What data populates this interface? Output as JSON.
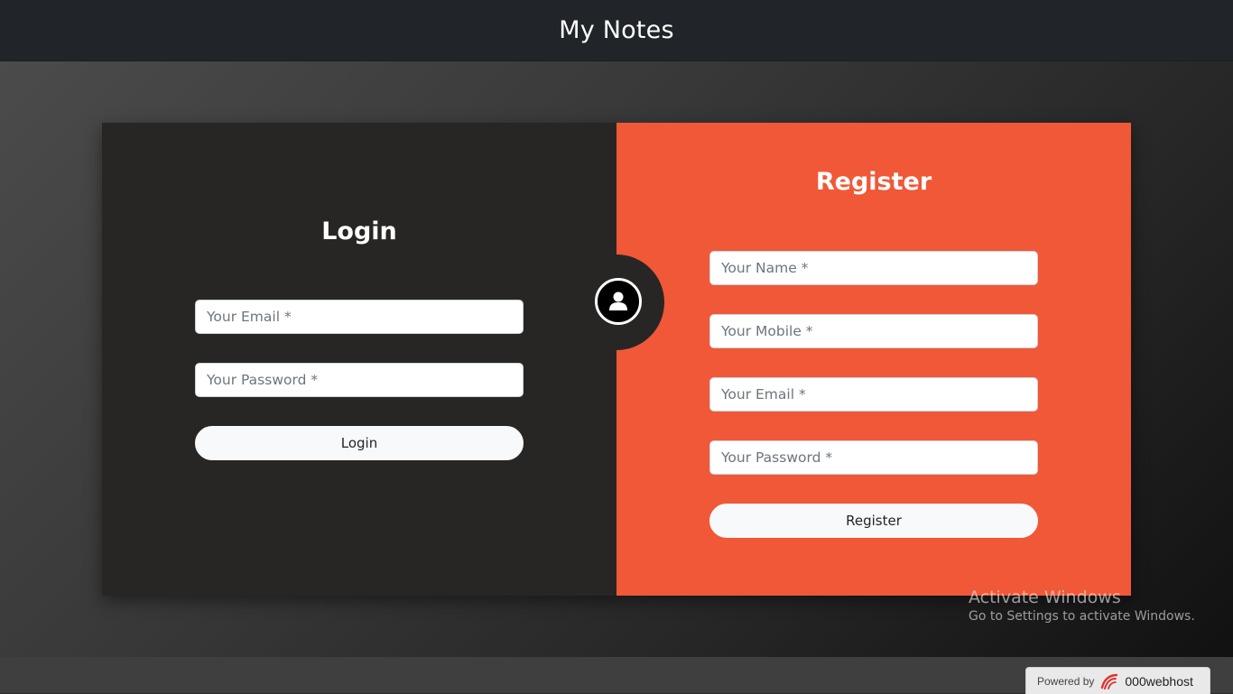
{
  "navbar": {
    "brand": "My Notes"
  },
  "login": {
    "title": "Login",
    "email_placeholder": "Your Email *",
    "password_placeholder": "Your Password *",
    "button_label": "Login"
  },
  "register": {
    "title": "Register",
    "name_placeholder": "Your Name *",
    "mobile_placeholder": "Your Mobile *",
    "email_placeholder": "Your Email *",
    "password_placeholder": "Your Password *",
    "button_label": "Register"
  },
  "icons": {
    "avatar": "user-icon",
    "host_logo": "000webhost-logo-icon"
  },
  "watermark": {
    "title": "Activate Windows",
    "subtitle": "Go to Settings to activate Windows."
  },
  "footer": {
    "powered_by": "Powered by",
    "host": "000webhost"
  },
  "colors": {
    "navbar": "#212529",
    "login_panel": "#282624",
    "register_panel": "#f05838",
    "button_bg": "#f8f9fa"
  }
}
